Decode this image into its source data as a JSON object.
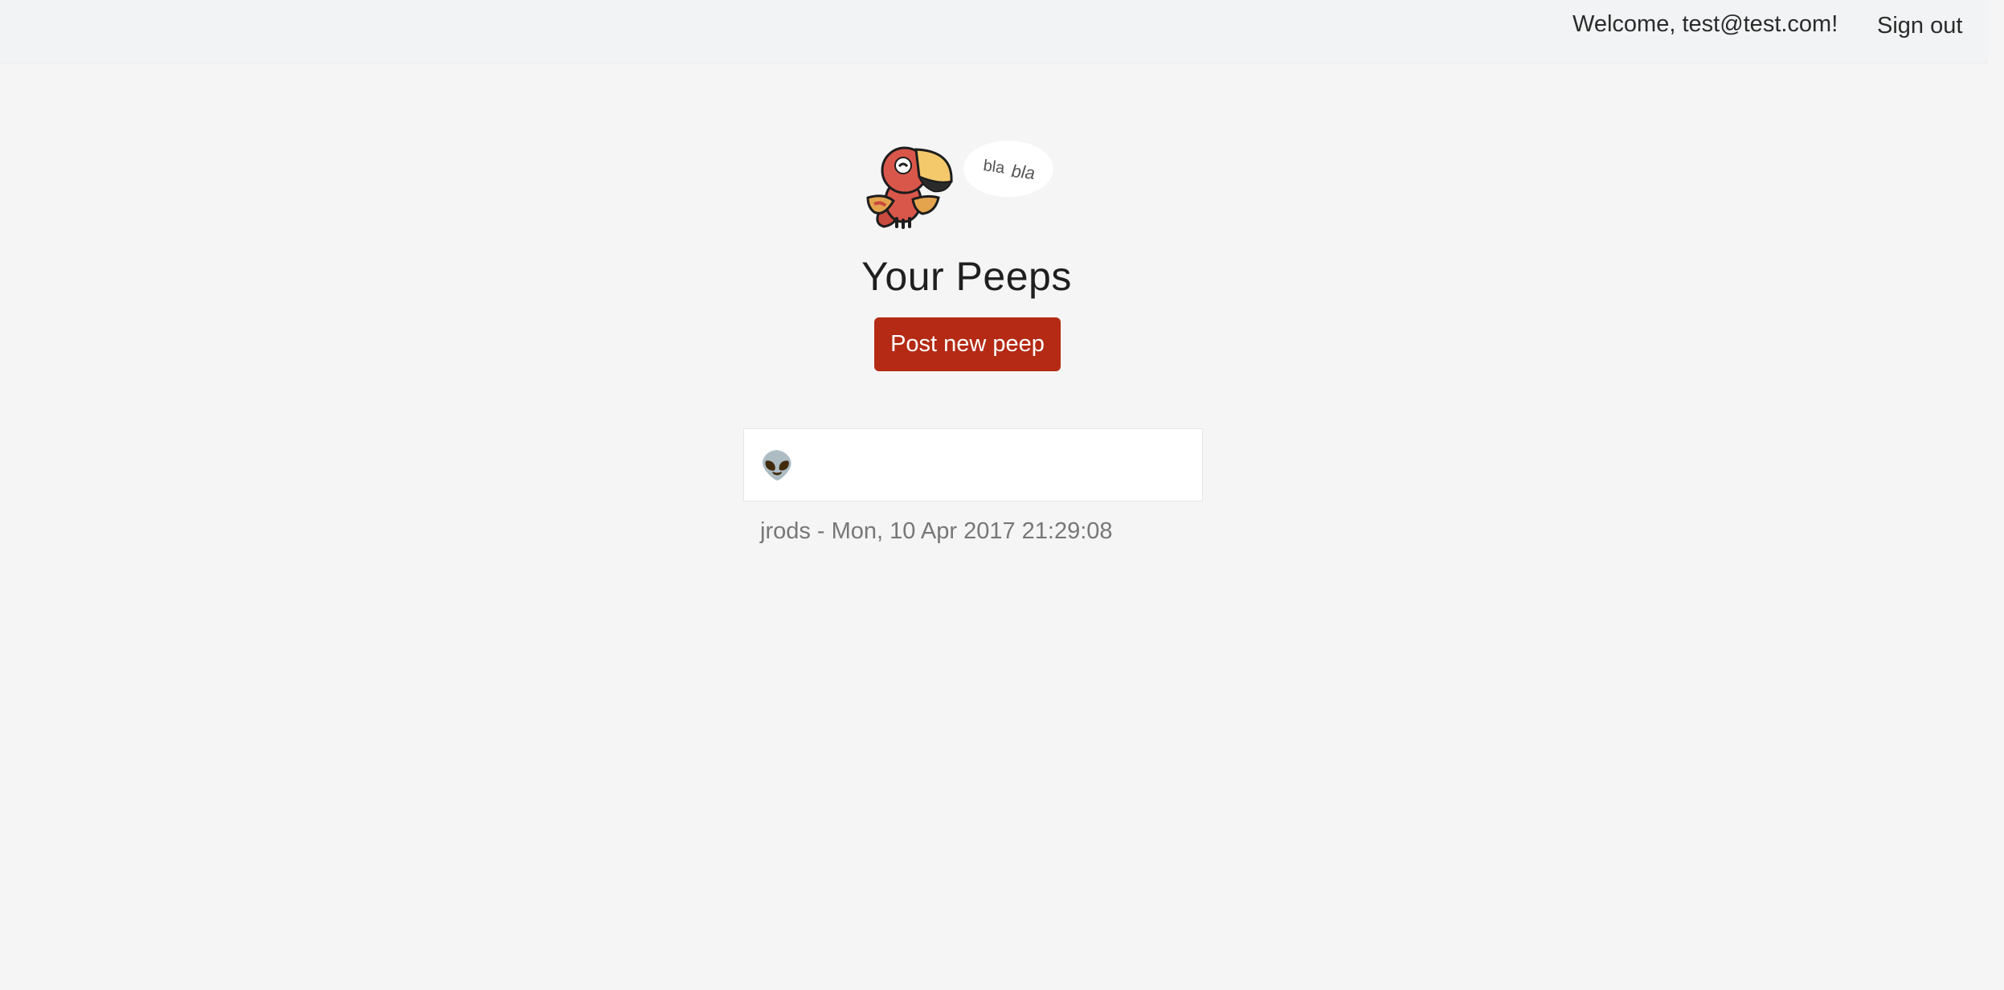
{
  "header": {
    "welcome_text": "Welcome, test@test.com!",
    "sign_out_label": "Sign out"
  },
  "logo": {
    "bubble_text_1": "bla",
    "bubble_text_2": "bla",
    "icon": "parrot-mascot-icon"
  },
  "main": {
    "title": "Your Peeps",
    "post_button_label": "Post new peep"
  },
  "peeps": [
    {
      "body": "👽",
      "author": "jrods",
      "separator": " - ",
      "timestamp": "Mon, 10 Apr 2017 21:29:08"
    }
  ],
  "colors": {
    "accent": "#b42a14",
    "background": "#f5f5f5",
    "topbar": "#f2f3f4",
    "parrot_body": "#d9574a",
    "parrot_beak": "#f3c96b"
  }
}
